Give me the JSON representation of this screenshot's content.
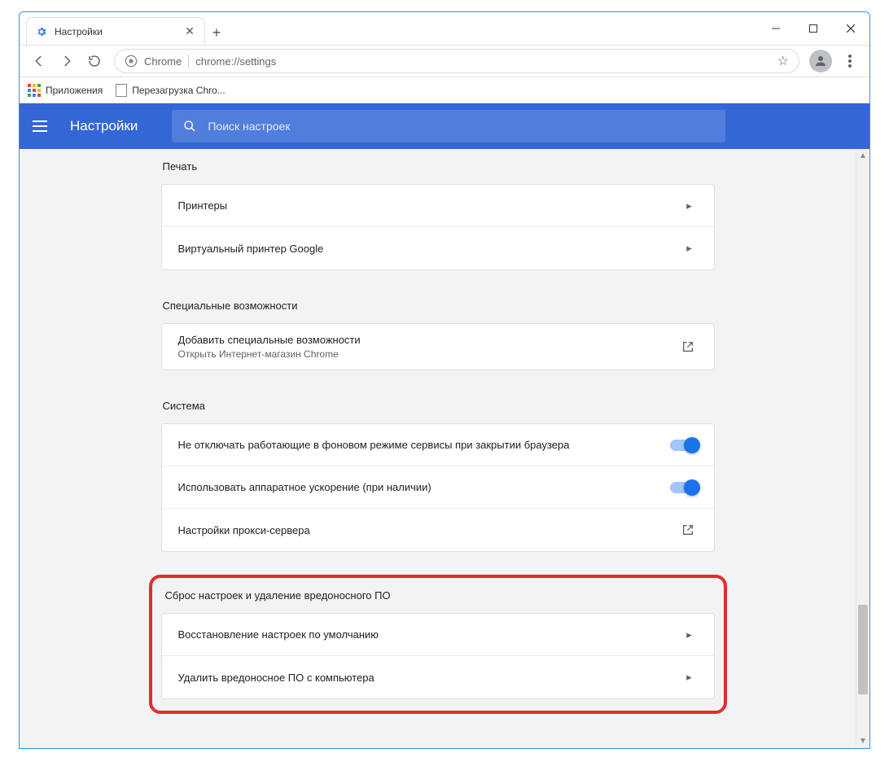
{
  "window": {
    "tab_title": "Настройки",
    "omnibox_label": "Chrome",
    "omnibox_url": "chrome://settings"
  },
  "bookmarks": {
    "apps": "Приложения",
    "item1": "Перезагрузка Chro..."
  },
  "header": {
    "title": "Настройки",
    "search_placeholder": "Поиск настроек"
  },
  "sections": {
    "print": {
      "title": "Печать",
      "items": {
        "printers": "Принтеры",
        "cloud": "Виртуальный принтер Google"
      }
    },
    "accessibility": {
      "title": "Специальные возможности",
      "items": {
        "add_main": "Добавить специальные возможности",
        "add_sub": "Открыть Интернет-магазин Chrome"
      }
    },
    "system": {
      "title": "Система",
      "items": {
        "background": "Не отключать работающие в фоновом режиме сервисы при закрытии браузера",
        "hw": "Использовать аппаратное ускорение (при наличии)",
        "proxy": "Настройки прокси-сервера"
      }
    },
    "reset": {
      "title": "Сброс настроек и удаление вредоносного ПО",
      "items": {
        "restore": "Восстановление настроек по умолчанию",
        "cleanup": "Удалить вредоносное ПО с компьютера"
      }
    }
  }
}
